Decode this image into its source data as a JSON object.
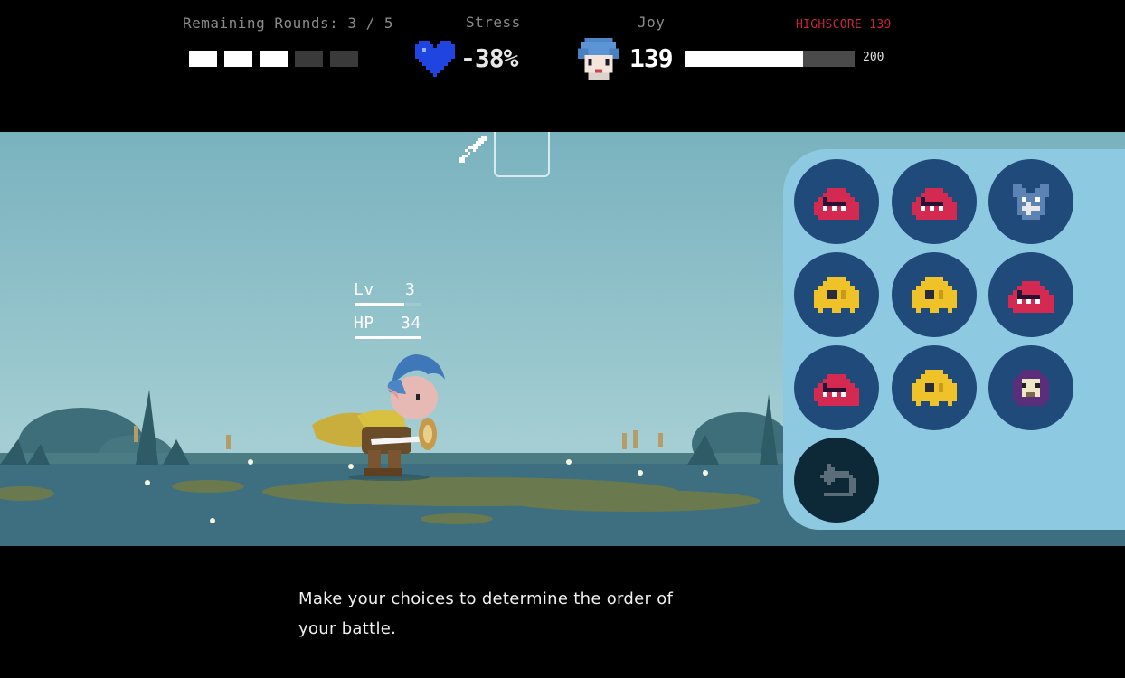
{
  "hud": {
    "rounds_label": "Remaining Rounds: 3 / 5",
    "rounds": {
      "total": 5,
      "remaining": 3
    },
    "stress_label": "Stress",
    "stress_value": "-38%",
    "stress_icon": "blue-heart-icon",
    "joy_label": "Joy",
    "joy_value": "139",
    "joy_max": "200",
    "joy_fraction": 0.695,
    "joy_icon": "hero-face-icon",
    "highscore": "HIGHSCORE 139"
  },
  "colors": {
    "heart": "#1f45e0",
    "highscore": "#c8253c",
    "sky": "#7ab3bf",
    "panel": "#8ec9e2",
    "enemy_button": "#1f4a7a",
    "undo_button": "#0d2836",
    "red_monster": "#d42a52",
    "yellow_monster": "#f0c22a"
  },
  "scene": {
    "action_icon": "sword-icon",
    "hero": {
      "lv_label": "Lv",
      "lv_value": "3",
      "hp_label": "HP",
      "hp_value": "34"
    }
  },
  "enemies": [
    {
      "icon": "red-slime-monster-icon"
    },
    {
      "icon": "red-slime-monster-icon"
    },
    {
      "icon": "blue-bat-monster-icon"
    },
    {
      "icon": "yellow-fish-monster-icon"
    },
    {
      "icon": "yellow-fish-monster-icon"
    },
    {
      "icon": "red-slime-monster-icon"
    },
    {
      "icon": "red-slime-monster-icon"
    },
    {
      "icon": "yellow-fish-monster-icon"
    },
    {
      "icon": "purple-hooded-skull-monster-icon"
    }
  ],
  "undo_icon": "undo-arrow-icon",
  "hint": "Make your choices to determine the order of your battle."
}
